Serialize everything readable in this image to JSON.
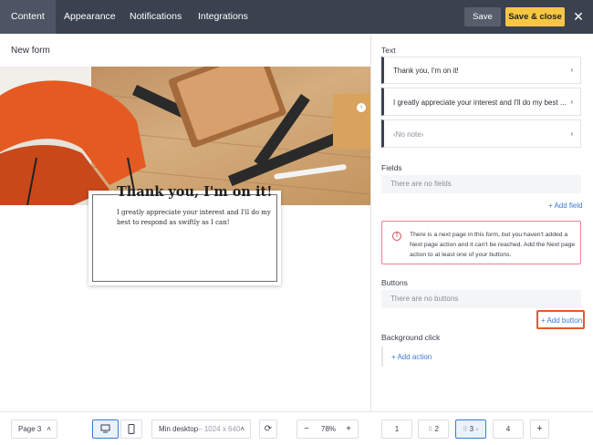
{
  "nav": {
    "tabs": [
      "Content",
      "Appearance",
      "Notifications",
      "Integrations"
    ],
    "active_tab": "Content",
    "save_label": "Save",
    "save_close_label": "Save & close"
  },
  "editor": {
    "form_title": "New form",
    "card": {
      "heading": "Thank you,  I'm on it!",
      "body": "I greatly appreciate your interest and I'll do my best to respond as swiftly as I can!"
    }
  },
  "panel": {
    "text_label": "Text",
    "text_items": [
      "Thank you,  I'm on it!",
      "I greatly appreciate your interest and I'll do my best ...",
      "‹No note›"
    ],
    "fields_label": "Fields",
    "fields_empty": "There are no fields",
    "add_field": "+ Add field",
    "warning": "There is a next page in this form, but you haven't added a Next page action and it can't be reached. Add the Next page action to at least one of your buttons.",
    "buttons_label": "Buttons",
    "buttons_empty": "There are no buttons",
    "add_button": "+ Add button",
    "background_label": "Background click",
    "add_action": "+ Add action"
  },
  "bottom": {
    "page_select": "Page 3",
    "device_select": "Min desktop",
    "device_size": "– 1024 x 640",
    "zoom": "78%",
    "pages": [
      "1",
      "2",
      "3",
      "4"
    ],
    "selected_page": "3"
  },
  "colors": {
    "nav_bg": "#3a4250",
    "accent_yellow": "#f7c744",
    "link_blue": "#3a7bd5",
    "warning_red": "#d94a57",
    "highlight_orange": "#e35a2b"
  }
}
